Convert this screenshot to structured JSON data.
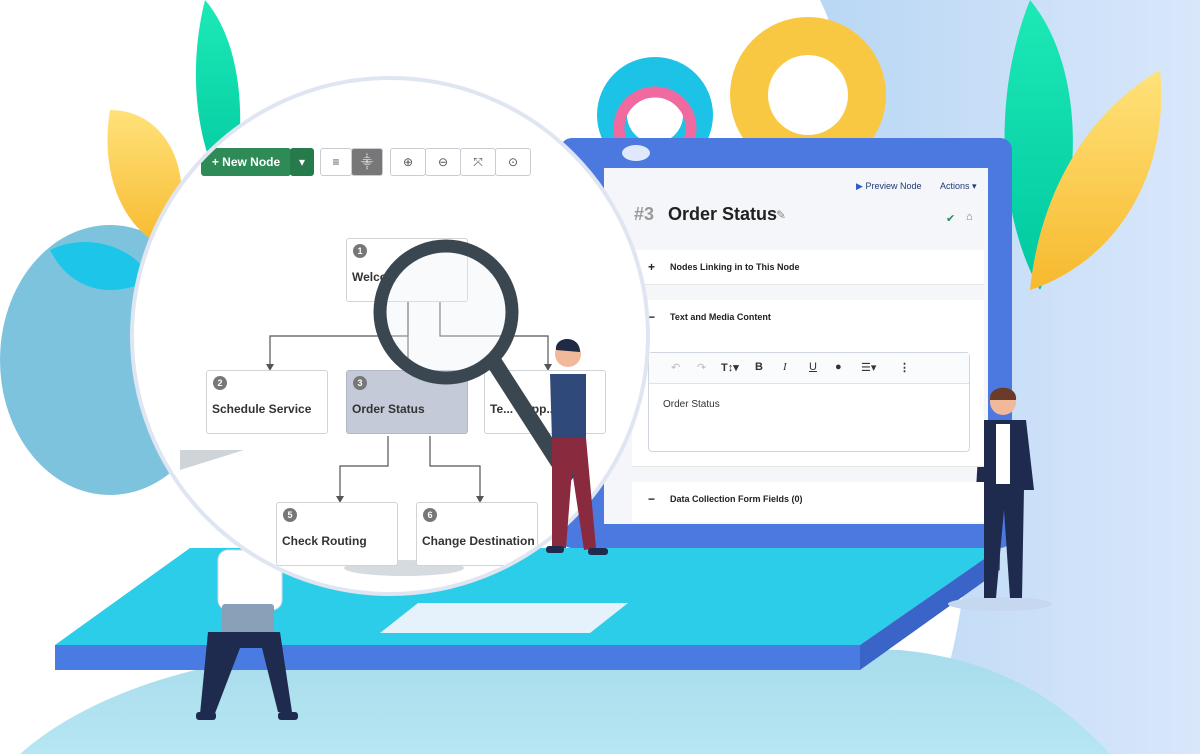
{
  "colors": {
    "accent_green": "#2e8b57",
    "screen_blue": "#4c79e0",
    "selected_node": "#c5cad9",
    "base_cyan": "#2ccde8"
  },
  "toolbar": {
    "new_node_label": "New Node",
    "plus_icon": "plus-icon",
    "dropdown_icon": "caret-down-icon",
    "list_view_icon": "list-icon",
    "tree_view_icon": "sitemap-icon",
    "zoom_in_icon": "zoom-in-icon",
    "zoom_out_icon": "zoom-out-icon",
    "fit_icon": "expand-icon",
    "reset_zoom_icon": "zoom-reset-icon"
  },
  "flow_nodes": [
    {
      "num": "1",
      "label": "Welco"
    },
    {
      "num": "2",
      "label": "Schedule Service"
    },
    {
      "num": "3",
      "label": "Order Status"
    },
    {
      "num": "",
      "label": "Te... Supp..."
    },
    {
      "num": "5",
      "label": "Check Routing"
    },
    {
      "num": "6",
      "label": "Change Destination"
    }
  ],
  "panel": {
    "preview_label": "Preview Node",
    "actions_label": "Actions",
    "node_number": "#3",
    "node_title": "Order Status",
    "sections": [
      {
        "symbol": "+",
        "label": "Nodes Linking in to This Node"
      },
      {
        "symbol": "−",
        "label": "Text and Media Content"
      },
      {
        "symbol": "−",
        "label": "Data Collection Form Fields (0)"
      }
    ],
    "editor_text": "Order Status",
    "editor_tools": [
      "undo-icon",
      "redo-icon",
      "text-size-icon",
      "bold-icon",
      "italic-icon",
      "underline-icon",
      "color-drop-icon",
      "list-icon",
      "more-icon"
    ]
  }
}
